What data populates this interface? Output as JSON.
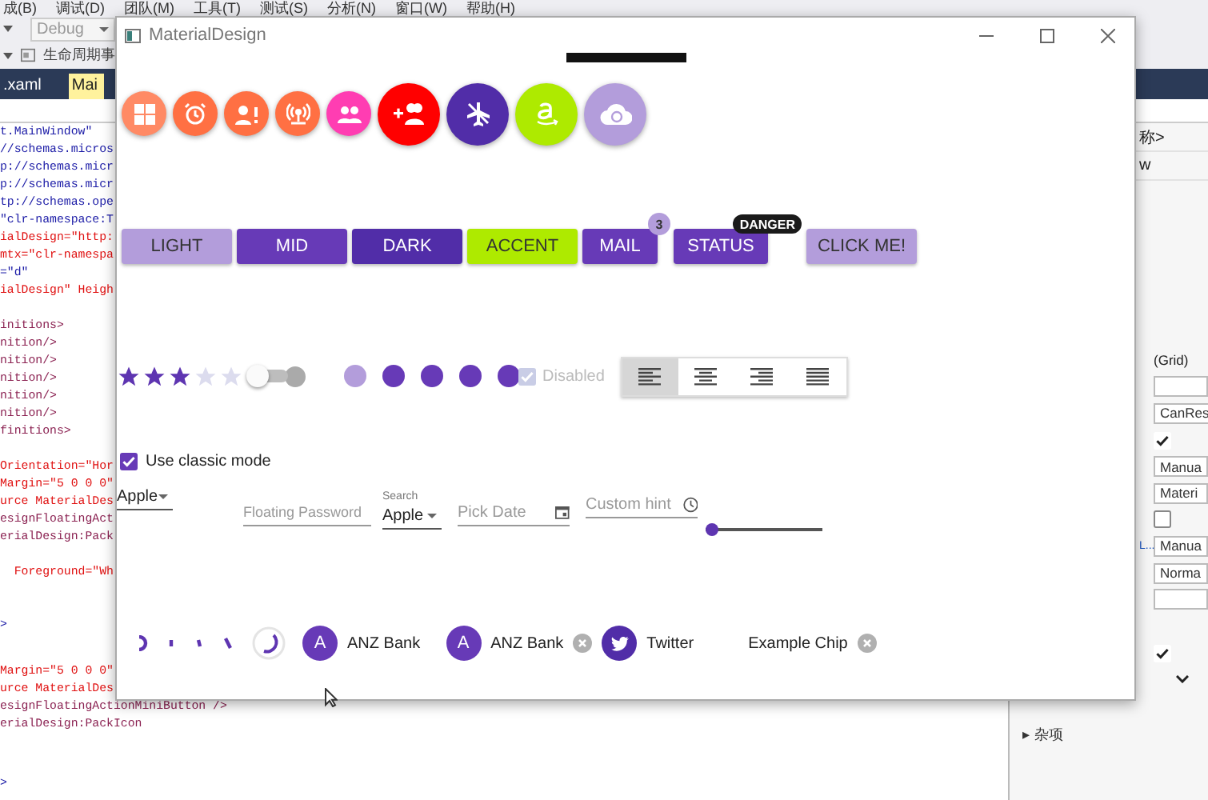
{
  "vs": {
    "menu": [
      "成(B)",
      "调试(D)",
      "团队(M)",
      "工具(T)",
      "测试(S)",
      "分析(N)",
      "窗口(W)",
      "帮助(H)"
    ],
    "config_combo": {
      "value": "Debug"
    },
    "lifecycle_label": "生命周期事",
    "doc_tabs": [
      {
        "label": ".xaml",
        "selected": false
      },
      {
        "label": "Mai",
        "selected": true
      }
    ],
    "code_blocks": [
      {
        "lines": [
          {
            "text": "t.MainWindow\"",
            "kind": "value"
          },
          {
            "text": "//schemas.micros",
            "kind": "value"
          },
          {
            "text": "p://schemas.micr",
            "kind": "value"
          },
          {
            "text": "p://schemas.micr",
            "kind": "value"
          },
          {
            "text": "tp://schemas.ope",
            "kind": "value"
          },
          {
            "text": "\"clr-namespace:T",
            "kind": "value"
          },
          {
            "text": "ialDesign=\"http:",
            "kind": "attr"
          },
          {
            "text": "mtx=\"clr-namespa",
            "kind": "attr"
          },
          {
            "text": "=\"d\"",
            "kind": "value"
          },
          {
            "text": "ialDesign\" Heigh",
            "kind": "attr"
          }
        ]
      },
      {
        "lines": [
          {
            "text": "initions>",
            "kind": "tag"
          },
          {
            "text": "nition/>",
            "kind": "tag"
          },
          {
            "text": "nition/>",
            "kind": "tag"
          },
          {
            "text": "nition/>",
            "kind": "tag"
          },
          {
            "text": "nition/>",
            "kind": "tag"
          },
          {
            "text": "nition/>",
            "kind": "tag"
          },
          {
            "text": "finitions>",
            "kind": "tag"
          }
        ]
      },
      {
        "lines": [
          {
            "text": "Orientation=\"Hor",
            "kind": "attr"
          },
          {
            "text": "Margin=\"5 0 0 0\"",
            "kind": "attr"
          },
          {
            "text": "urce MaterialDes",
            "kind": "attr"
          },
          {
            "text": "esignFloatingAct",
            "kind": "tag"
          },
          {
            "text": "erialDesign:Pack",
            "kind": "tag"
          }
        ]
      },
      {
        "lines": [
          {
            "text": "  Foreground=\"Wh",
            "kind": "attr"
          }
        ]
      },
      {
        "lines": [
          {
            "text": ">",
            "kind": "value"
          }
        ]
      },
      {
        "lines": [
          {
            "text": "Margin=\"5 0 0 0\"",
            "kind": "attr"
          },
          {
            "text": "urce MaterialDes",
            "kind": "attr"
          },
          {
            "text": "esignFloatingActionMiniButton />",
            "kind": "tag"
          },
          {
            "text": "erialDesign:PackIcon",
            "kind": "tag"
          }
        ]
      },
      {
        "lines": [
          {
            "text": ">",
            "kind": "value"
          }
        ]
      }
    ],
    "property_header": [
      "称>",
      "w"
    ],
    "property_values": [
      {
        "kind": "label",
        "text": "(Grid)"
      },
      {
        "kind": "field"
      },
      {
        "kind": "field",
        "text": "CanRes"
      },
      {
        "kind": "checkbox",
        "checked": true
      },
      {
        "kind": "field",
        "text": "Manua"
      },
      {
        "kind": "field",
        "text": "Materi"
      },
      {
        "kind": "checkbox",
        "checked": false
      },
      {
        "kind": "field",
        "text": "Manua",
        "link": "L..."
      },
      {
        "kind": "field",
        "text": "Norma"
      },
      {
        "kind": "field"
      }
    ],
    "property_lower": [
      {
        "kind": "checkbox",
        "checked": true
      },
      {
        "kind": "chevron"
      }
    ],
    "misc_section": {
      "arrow": "▸",
      "label": "杂项"
    }
  },
  "window": {
    "title": "MaterialDesign",
    "fabs": [
      {
        "kind": "windows",
        "color": "#ff8a65",
        "mini": true
      },
      {
        "kind": "alarm",
        "color": "#ff7043",
        "mini": true
      },
      {
        "kind": "account-alert",
        "color": "#ff7043",
        "mini": true
      },
      {
        "kind": "access-point",
        "color": "#ff7043",
        "mini": true
      },
      {
        "kind": "people",
        "color": "#ff3db2",
        "mini": true
      },
      {
        "kind": "add-people",
        "color": "#ff0000",
        "mini": false
      },
      {
        "kind": "airplane-off",
        "color": "#512da8",
        "mini": false
      },
      {
        "kind": "smile-logo",
        "color": "#aeea00",
        "mini": false
      },
      {
        "kind": "cloud",
        "color": "#b39ddb",
        "mini": false
      }
    ],
    "buttons": [
      {
        "label": "LIGHT",
        "color": "#b39ddb"
      },
      {
        "label": "MID",
        "color": "#673ab7"
      },
      {
        "label": "DARK",
        "color": "#512da8"
      },
      {
        "label": "ACCENT",
        "color": "#aeea00"
      },
      {
        "label": "MAIL",
        "color": "#673ab7",
        "badge": {
          "kind": "count",
          "text": "3"
        }
      },
      {
        "label": "STATUS",
        "color": "#673ab7",
        "badge": {
          "kind": "tag",
          "text": "DANGER"
        }
      },
      {
        "label": "CLICK ME!",
        "color": "#b39ddb"
      }
    ],
    "rating": {
      "stars": 3
    },
    "switch": {
      "on": false
    },
    "circle_toggles": [
      {
        "checked": false
      },
      {
        "checked": true
      },
      {
        "checked": true
      },
      {
        "checked": true
      },
      {
        "checked": true
      }
    ],
    "disabled_checkbox": {
      "label": "Disabled",
      "checked": true,
      "disabled": true
    },
    "alignment": [
      {
        "kind": "left",
        "selected": true
      },
      {
        "kind": "center",
        "selected": false
      },
      {
        "kind": "right",
        "selected": false
      },
      {
        "kind": "justify",
        "selected": false
      }
    ],
    "classic_mode": {
      "label": "Use classic mode",
      "checked": true
    },
    "combo": {
      "value": "Apple"
    },
    "password": {
      "placeholder": "Floating Password"
    },
    "search_combo": {
      "label": "Search",
      "value": "Apple"
    },
    "date": {
      "placeholder": "Pick Date"
    },
    "time": {
      "placeholder": "Custom hint"
    },
    "slider": {
      "level": 0
    },
    "chips": [
      {
        "kind": "letter",
        "avatar": "A",
        "label": "ANZ Bank",
        "deletable": false
      },
      {
        "kind": "letter",
        "avatar": "A",
        "label": "ANZ Bank",
        "deletable": true
      },
      {
        "kind": "bird",
        "label": "Twitter",
        "deletable": false
      },
      {
        "kind": "plain",
        "label": "Example Chip",
        "deletable": true
      }
    ]
  }
}
